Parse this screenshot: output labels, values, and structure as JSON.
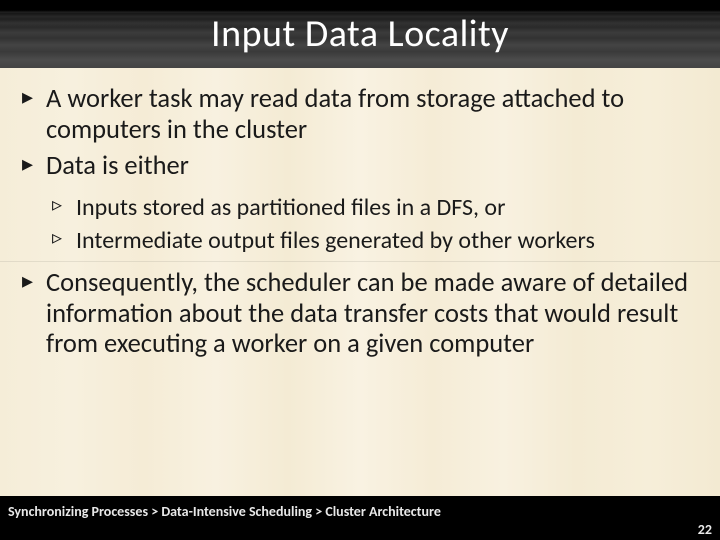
{
  "title": "Input Data Locality",
  "bullets": {
    "b1": "A worker task may read data from storage attached to computers in the cluster",
    "b2": "Data is either",
    "b2a": "Inputs stored as partitioned files in a DFS, or",
    "b2b": "Intermediate output files generated by other workers",
    "b3": "Consequently, the scheduler can be made aware of detailed information about the data transfer costs that would result from executing a worker on a given computer"
  },
  "breadcrumb": "Synchronizing Processes > Data-Intensive Scheduling > Cluster Architecture",
  "page_number": "22"
}
